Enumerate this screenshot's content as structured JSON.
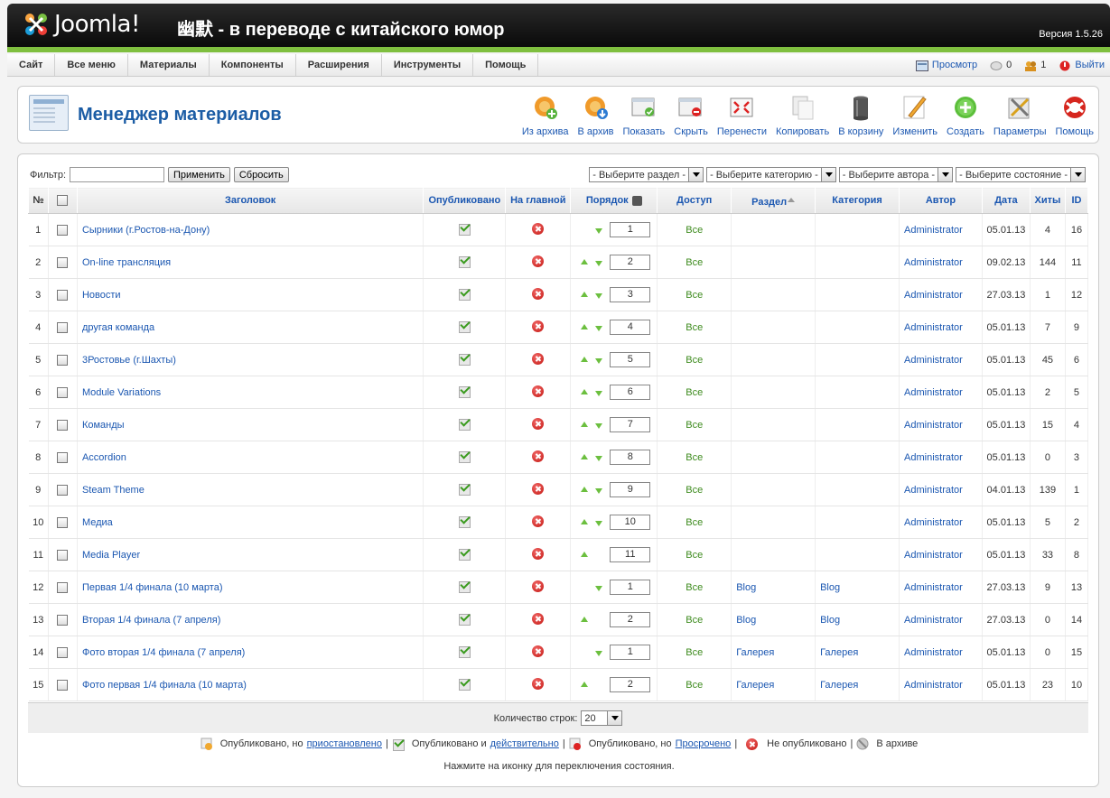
{
  "header": {
    "brand": "Joomla!",
    "site_title": "幽默 - в переводе с китайского юмор",
    "version": "Версия 1.5.26"
  },
  "menu": [
    "Сайт",
    "Все меню",
    "Материалы",
    "Компоненты",
    "Расширения",
    "Инструменты",
    "Помощь"
  ],
  "status": {
    "preview": "Просмотр",
    "messages": "0",
    "users": "1",
    "logout": "Выйти"
  },
  "page": {
    "title": "Менеджер материалов"
  },
  "toolbar": [
    {
      "label": "Из архива",
      "icon": "unarchive-icon"
    },
    {
      "label": "В архив",
      "icon": "archive-icon"
    },
    {
      "label": "Показать",
      "icon": "publish-icon"
    },
    {
      "label": "Скрыть",
      "icon": "unpublish-icon"
    },
    {
      "label": "Перенести",
      "icon": "move-icon"
    },
    {
      "label": "Копировать",
      "icon": "copy-icon"
    },
    {
      "label": "В корзину",
      "icon": "trash-icon"
    },
    {
      "label": "Изменить",
      "icon": "edit-icon"
    },
    {
      "label": "Создать",
      "icon": "new-icon"
    },
    {
      "label": "Параметры",
      "icon": "parameters-icon"
    },
    {
      "label": "Помощь",
      "icon": "help-icon"
    }
  ],
  "filter": {
    "label": "Фильтр:",
    "value": "",
    "apply": "Применить",
    "reset": "Сбросить",
    "selects": [
      "- Выберите раздел -",
      "- Выберите категорию -",
      "- Выберите автора -",
      "- Выберите состояние -"
    ]
  },
  "columns": [
    "№",
    "",
    "Заголовок",
    "Опубликовано",
    "На главной",
    "Порядок",
    "Доступ",
    "Раздел",
    "Категория",
    "Автор",
    "Дата",
    "Хиты",
    "ID"
  ],
  "rows": [
    {
      "n": "1",
      "title": "Сырники (г.Ростов-на-Дону)",
      "up": false,
      "down": true,
      "order": "1",
      "access": "Все",
      "section": "",
      "category": "",
      "author": "Administrator",
      "date": "05.01.13",
      "hits": "4",
      "id": "16"
    },
    {
      "n": "2",
      "title": "On-line трансляция",
      "up": true,
      "down": true,
      "order": "2",
      "access": "Все",
      "section": "",
      "category": "",
      "author": "Administrator",
      "date": "09.02.13",
      "hits": "144",
      "id": "11"
    },
    {
      "n": "3",
      "title": "Новости",
      "up": true,
      "down": true,
      "order": "3",
      "access": "Все",
      "section": "",
      "category": "",
      "author": "Administrator",
      "date": "27.03.13",
      "hits": "1",
      "id": "12"
    },
    {
      "n": "4",
      "title": "другая команда",
      "up": true,
      "down": true,
      "order": "4",
      "access": "Все",
      "section": "",
      "category": "",
      "author": "Administrator",
      "date": "05.01.13",
      "hits": "7",
      "id": "9"
    },
    {
      "n": "5",
      "title": "3Ростовье (г.Шахты)",
      "up": true,
      "down": true,
      "order": "5",
      "access": "Все",
      "section": "",
      "category": "",
      "author": "Administrator",
      "date": "05.01.13",
      "hits": "45",
      "id": "6"
    },
    {
      "n": "6",
      "title": "Module Variations",
      "up": true,
      "down": true,
      "order": "6",
      "access": "Все",
      "section": "",
      "category": "",
      "author": "Administrator",
      "date": "05.01.13",
      "hits": "2",
      "id": "5"
    },
    {
      "n": "7",
      "title": "Команды",
      "up": true,
      "down": true,
      "order": "7",
      "access": "Все",
      "section": "",
      "category": "",
      "author": "Administrator",
      "date": "05.01.13",
      "hits": "15",
      "id": "4"
    },
    {
      "n": "8",
      "title": "Accordion",
      "up": true,
      "down": true,
      "order": "8",
      "access": "Все",
      "section": "",
      "category": "",
      "author": "Administrator",
      "date": "05.01.13",
      "hits": "0",
      "id": "3"
    },
    {
      "n": "9",
      "title": "Steam Theme",
      "up": true,
      "down": true,
      "order": "9",
      "access": "Все",
      "section": "",
      "category": "",
      "author": "Administrator",
      "date": "04.01.13",
      "hits": "139",
      "id": "1"
    },
    {
      "n": "10",
      "title": "Медиа",
      "up": true,
      "down": true,
      "order": "10",
      "access": "Все",
      "section": "",
      "category": "",
      "author": "Administrator",
      "date": "05.01.13",
      "hits": "5",
      "id": "2"
    },
    {
      "n": "11",
      "title": "Media Player",
      "up": true,
      "down": false,
      "order": "11",
      "access": "Все",
      "section": "",
      "category": "",
      "author": "Administrator",
      "date": "05.01.13",
      "hits": "33",
      "id": "8"
    },
    {
      "n": "12",
      "title": "Первая 1/4 финала (10 марта)",
      "up": false,
      "down": true,
      "order": "1",
      "access": "Все",
      "section": "Blog",
      "category": "Blog",
      "author": "Administrator",
      "date": "27.03.13",
      "hits": "9",
      "id": "13"
    },
    {
      "n": "13",
      "title": "Вторая 1/4 финала (7 апреля)",
      "up": true,
      "down": false,
      "order": "2",
      "access": "Все",
      "section": "Blog",
      "category": "Blog",
      "author": "Administrator",
      "date": "27.03.13",
      "hits": "0",
      "id": "14"
    },
    {
      "n": "14",
      "title": "Фото вторая 1/4 финала (7 апреля)",
      "up": false,
      "down": true,
      "order": "1",
      "access": "Все",
      "section": "Галерея",
      "category": "Галерея",
      "author": "Administrator",
      "date": "05.01.13",
      "hits": "0",
      "id": "15"
    },
    {
      "n": "15",
      "title": "Фото первая 1/4 финала (10 марта)",
      "up": true,
      "down": false,
      "order": "2",
      "access": "Все",
      "section": "Галерея",
      "category": "Галерея",
      "author": "Administrator",
      "date": "05.01.13",
      "hits": "23",
      "id": "10"
    }
  ],
  "pagination": {
    "label": "Количество строк:",
    "value": "20"
  },
  "legend": {
    "pending_a": "Опубликовано, но",
    "pending_b": "приостановлено",
    "current_a": "Опубликовано и",
    "current_b": "действительно",
    "expired_a": "Опубликовано, но",
    "expired_b": "Просрочено",
    "unpublished": "Не опубликовано",
    "archived": "В архиве",
    "sep": "|",
    "hint": "Нажмите на иконку для переключения состояния."
  },
  "colors": {
    "accent": "#1b57b1",
    "brand_green": "#7fbf3f",
    "access_green": "#3c8a1c",
    "title_blue": "#1c5da5"
  }
}
